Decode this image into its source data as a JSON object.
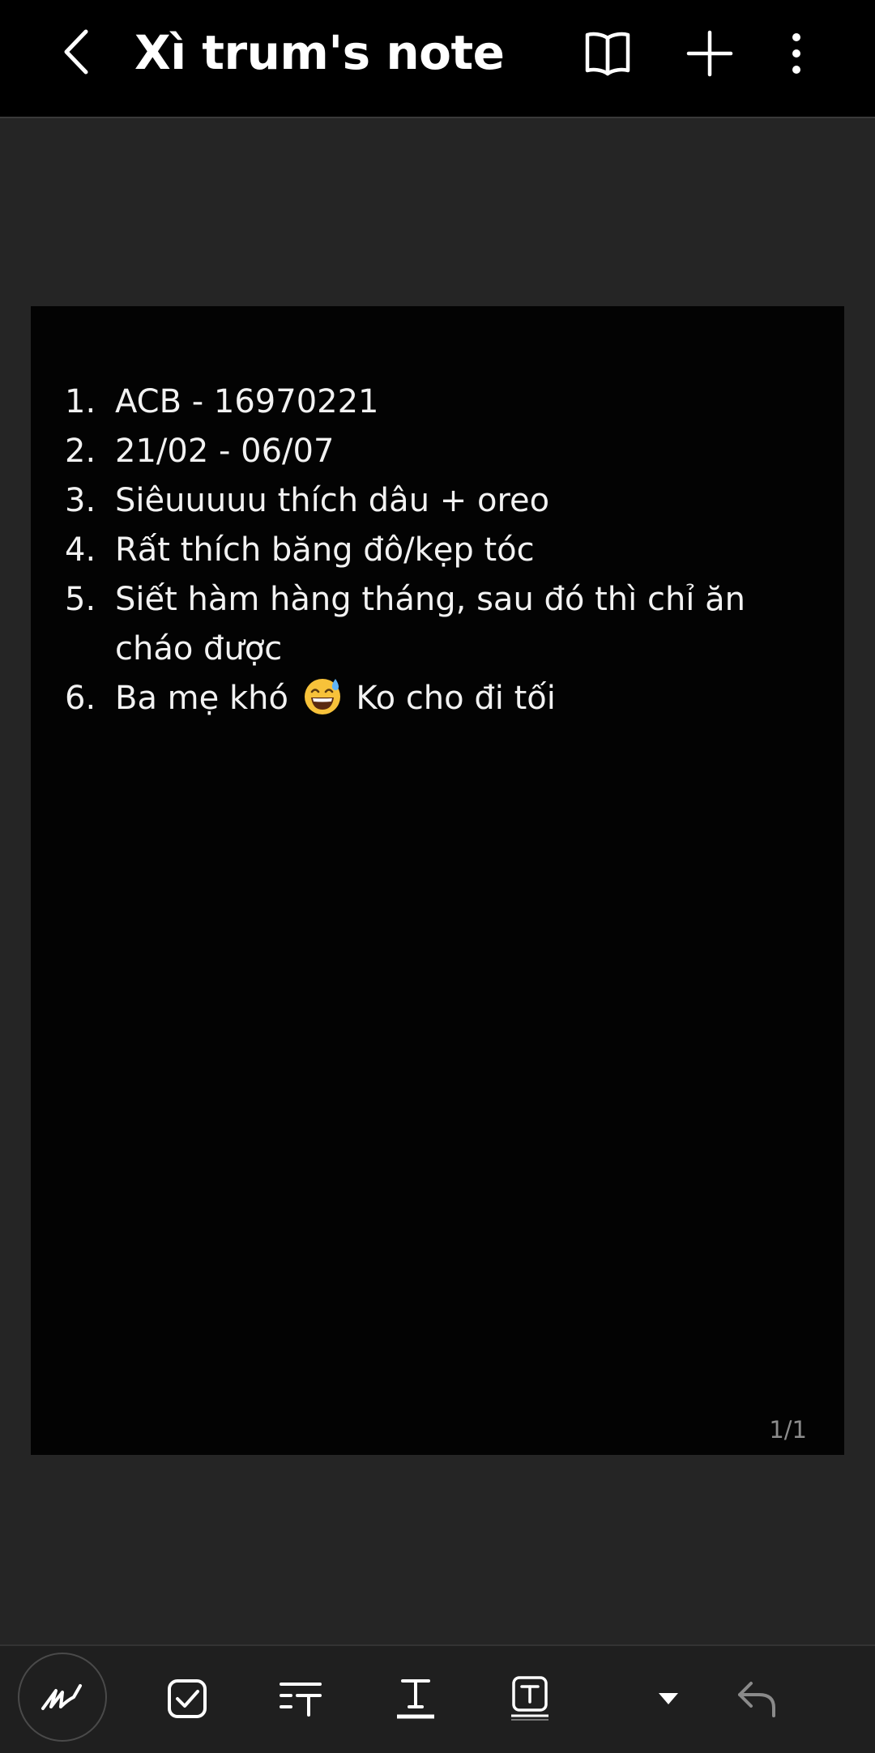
{
  "header": {
    "title": "Xì trum's note",
    "back_icon": "chevron-left-icon",
    "reading_mode_icon": "book-open-icon",
    "add_icon": "plus-icon",
    "more_icon": "more-vertical-icon"
  },
  "note": {
    "items": [
      {
        "num": "1.",
        "text": "ACB - 16970221"
      },
      {
        "num": "2.",
        "text": "21/02 - 06/07"
      },
      {
        "num": "3.",
        "text": "Siêuuuuu thích dâu + oreo"
      },
      {
        "num": "4.",
        "text": "Rất thích băng đô/kẹp tóc"
      },
      {
        "num": "5.",
        "text": "Siết hàm hàng tháng, sau đó thì chỉ ăn cháo được"
      },
      {
        "num": "6.",
        "text_before": "Ba mẹ khó",
        "emoji": "grinning-sweat-emoji",
        "text_after": "Ko cho đi tối"
      }
    ],
    "page_counter": "1/1"
  },
  "toolbar": {
    "tools": [
      "handwriting-pen-icon",
      "checkbox-icon",
      "text-format-icon",
      "text-underline-icon",
      "text-box-icon",
      "dropdown-arrow-icon",
      "undo-icon"
    ]
  },
  "colors": {
    "topbar_bg": "#000000",
    "canvas_bg": "#252525",
    "page_bg": "#030303",
    "text": "#f2f2f2",
    "emoji": "#f7c23a"
  }
}
